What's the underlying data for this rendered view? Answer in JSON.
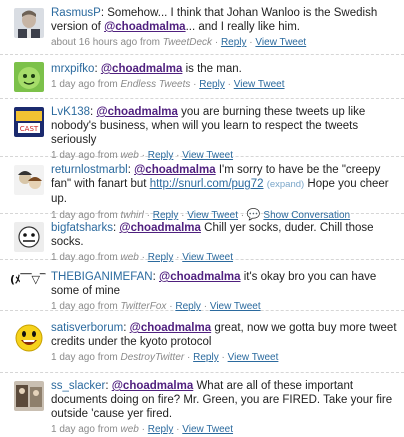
{
  "tweets": [
    {
      "user": "RasmusP",
      "parts": [
        ": Somehow... I think that Johan Wanloo is the Swedish version of "
      ],
      "mention": "@choadmalma",
      "after": "... and I really like him.",
      "time": "about 16 hours ago from",
      "source": "TweetDeck",
      "reply": "Reply",
      "view": "View Tweet",
      "avatar_color": "#8a8f99"
    },
    {
      "user": "mrxpifko",
      "parts": [
        ": "
      ],
      "mention": "@choadmalma",
      "after": " is the man.",
      "time": "1 day ago from",
      "source": "Endless Tweets",
      "reply": "Reply",
      "view": "View Tweet",
      "avatar_color": "#6dbb3f"
    },
    {
      "user": "LvK138",
      "parts": [
        ": "
      ],
      "mention": "@choadmalma",
      "after": " you are burning these tweets up like nobody's business, when will you learn to respect the tweets seriously",
      "time": "1 day ago from",
      "source": "web",
      "reply": "Reply",
      "view": "View Tweet",
      "avatar_color": "#2d3d8f"
    },
    {
      "user": "returnlostmarbl",
      "parts": [
        ": "
      ],
      "mention": "@choadmalma",
      "after": " I'm sorry to have be the \"creepy fan\" with fanart but ",
      "url": "http://snurl.com/pug72",
      "expand": "(expand)",
      "after2": " Hope you cheer up.",
      "time": "1 day ago from",
      "source": "twhirl",
      "reply": "Reply",
      "view": "View Tweet",
      "convo": "Show Conversation",
      "avatar_color": "#9a9a9a"
    },
    {
      "user": "bigfatsharks",
      "parts": [
        ": "
      ],
      "mention": "@choadmalma",
      "after": " Chill yer socks, duder. Chill those socks.",
      "time": "1 day ago from",
      "source": "web",
      "reply": "Reply",
      "view": "View Tweet",
      "avatar_color": "#5a5a5a"
    },
    {
      "user": "THEBIGANIMEFAN",
      "parts": [
        ": "
      ],
      "mention": "@choadmalma",
      "after": " it's okay bro you can have some of mine",
      "time": "1 day ago from",
      "source": "TwitterFox",
      "reply": "Reply",
      "view": "View Tweet",
      "avatar_text": "(ﾒ￣▽￣)",
      "avatar_color": "#ffffff"
    },
    {
      "user": "satisverborum",
      "parts": [
        ": "
      ],
      "mention": "@choadmalma",
      "after": " great, now we gotta buy more tweet credits under the kyoto protocol",
      "time": "1 day ago from",
      "source": "DestroyTwitter",
      "reply": "Reply",
      "view": "View Tweet",
      "avatar_color": "#f2d21a"
    },
    {
      "user": "ss_slacker",
      "parts": [
        ": "
      ],
      "mention": "@choadmalma",
      "after": " What are all of these important documents doing on fire? Mr. Green, you are FIRED. Take your fire outside 'cause yer fired.",
      "time": "1 day ago from",
      "source": "web",
      "reply": "Reply",
      "view": "View Tweet",
      "avatar_color": "#6b5b4b"
    }
  ]
}
